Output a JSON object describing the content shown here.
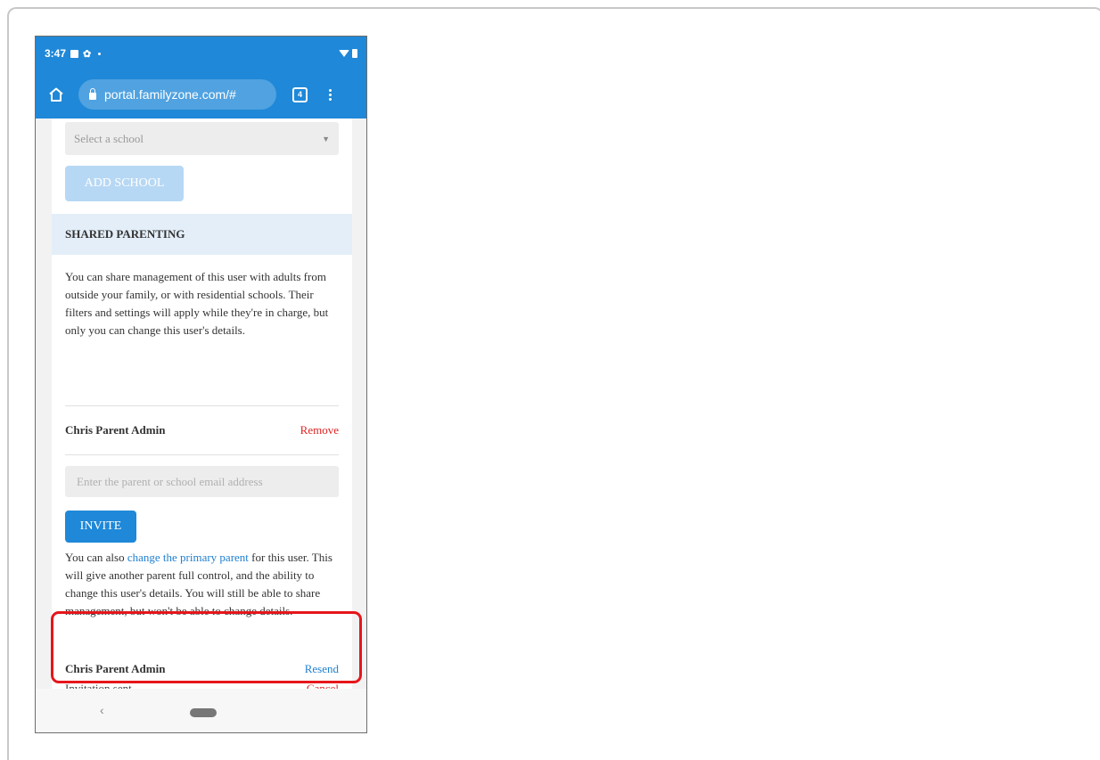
{
  "status_bar": {
    "time": "3:47"
  },
  "browser": {
    "url": "portal.familyzone.com/#",
    "tab_count": "4"
  },
  "school": {
    "select_placeholder": "Select a school",
    "add_button": "ADD SCHOOL"
  },
  "shared_parenting": {
    "header": "SHARED PARENTING",
    "description": "You can share management of this user with adults from outside your family, or with residential schools. Their filters and settings will apply while they're in charge, but only you can change this user's details.",
    "current_parent": {
      "name": "Chris Parent Admin",
      "remove_label": "Remove"
    },
    "email_placeholder": "Enter the parent or school email address",
    "invite_button": "INVITE",
    "primary_text_before": "You can also ",
    "primary_link": "change the primary parent",
    "primary_text_after": " for this user. This will give another parent full control, and the ability to change this user's details. You will still be able to share management, but won't be able to change details.",
    "pending_invite": {
      "name": "Chris Parent Admin",
      "status": "Invitation sent",
      "resend_label": "Resend",
      "cancel_label": "Cancel"
    }
  },
  "colors": {
    "accent": "#1f88d8",
    "link_blue": "#1f7fd0",
    "danger": "#e02323",
    "highlight": "#e6161b"
  },
  "icons": {
    "home": "home-icon",
    "lock": "lock-icon",
    "tabs": "tabs-icon",
    "menu": "more-vert-icon",
    "back": "back-chevron-icon",
    "nav_home": "home-pill-icon"
  }
}
